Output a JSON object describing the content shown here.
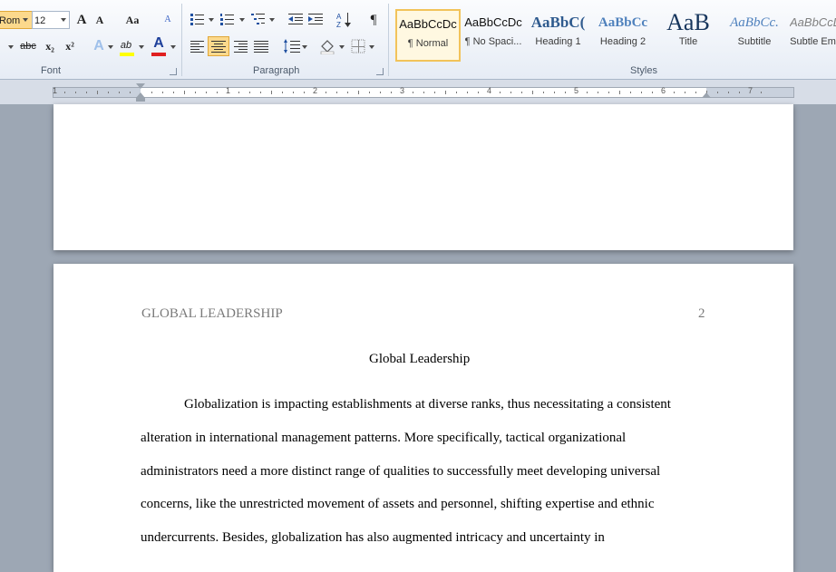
{
  "font": {
    "name": "Rom",
    "size": "12",
    "group_label": "Font",
    "grow_icon_label": "A",
    "shrink_icon_label": "A",
    "case_label": "Aa",
    "strike_label": "abc",
    "sub_label": "x₂",
    "sup_label": "x²",
    "effects_label": "A",
    "highlight_label": "ab",
    "color_label": "A",
    "clear_label": "A"
  },
  "paragraph": {
    "group_label": "Paragraph",
    "pilcrow": "¶"
  },
  "styles": {
    "group_label": "Styles",
    "items": [
      {
        "sample": "AaBbCcDc",
        "name": "¶ Normal"
      },
      {
        "sample": "AaBbCcDc",
        "name": "¶ No Spaci..."
      },
      {
        "sample": "AaBbC(",
        "name": "Heading 1"
      },
      {
        "sample": "AaBbCc",
        "name": "Heading 2"
      },
      {
        "sample": "AaB",
        "name": "Title"
      },
      {
        "sample": "AaBbCc.",
        "name": "Subtitle"
      },
      {
        "sample": "AaBbCcL",
        "name": "Subtle Em"
      }
    ]
  },
  "ruler": {
    "numbers": [
      "1",
      "1",
      "2",
      "3",
      "4",
      "5",
      "6",
      "7"
    ]
  },
  "document": {
    "running_head": "GLOBAL LEADERSHIP",
    "page_number": "2",
    "title": "Global Leadership",
    "lines": [
      "Globalization is impacting establishments at diverse ranks, thus necessitating a consistent",
      "alteration in international management patterns. More specifically, tactical organizational",
      "administrators need a more distinct range of qualities to successfully meet developing universal",
      "concerns, like the unrestricted movement of assets and personnel, shifting expertise and ethnic",
      "undercurrents. Besides, globalization has also augmented intricacy and uncertainty in"
    ]
  },
  "colors": {
    "accent_selected": "#f2c35a",
    "font_color_bar": "#e02020",
    "highlight_bar": "#ffff00"
  }
}
